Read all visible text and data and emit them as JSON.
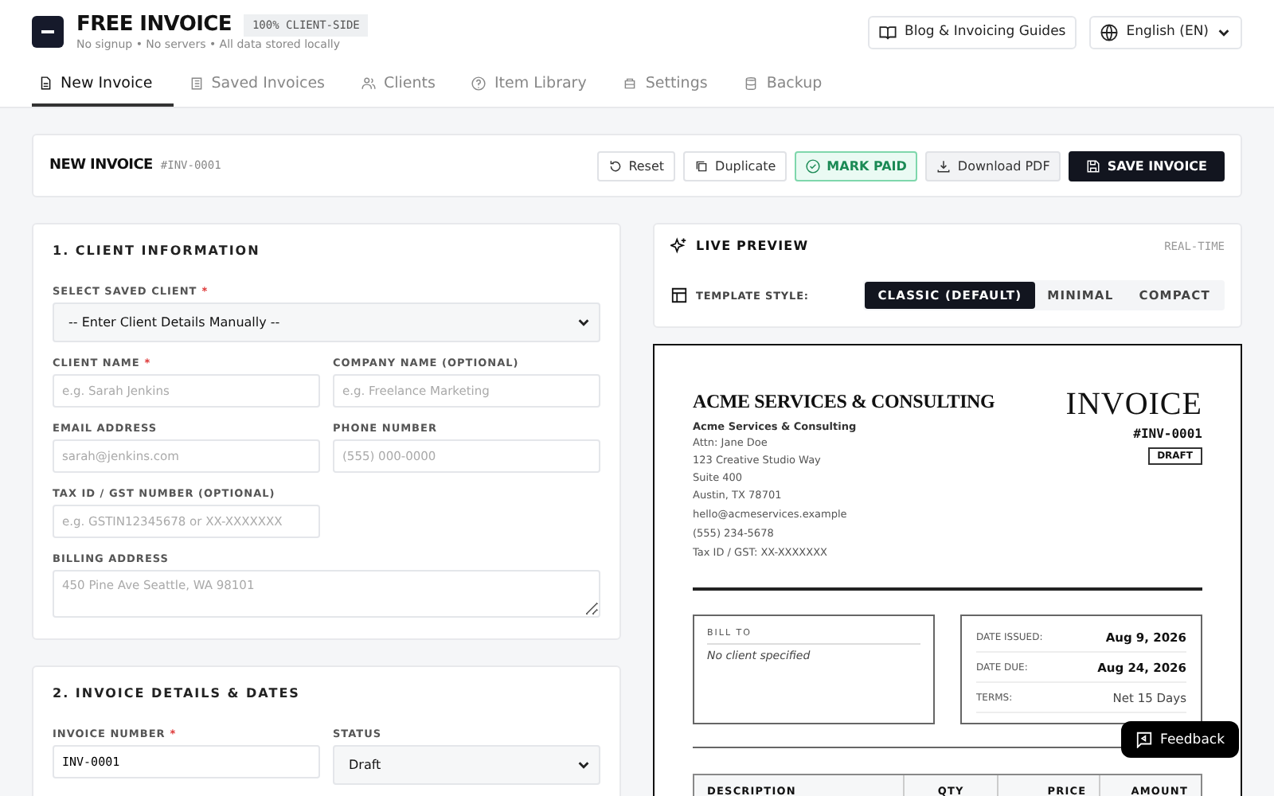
{
  "brand": {
    "title": "FREE INVOICE",
    "badge": "100% CLIENT-SIDE",
    "tagline": "No signup • No servers • All data stored locally"
  },
  "header_links": [
    {
      "kind": "guide",
      "label": "Blog & Invoicing Guides"
    },
    {
      "kind": "language",
      "label": "English (EN)"
    }
  ],
  "tabs": [
    {
      "kind": "file",
      "label": "New Invoice",
      "selected": true
    },
    {
      "kind": "list",
      "label": "Saved Invoices",
      "selected": false
    },
    {
      "kind": "users",
      "label": "Clients",
      "selected": false
    },
    {
      "kind": "tag",
      "label": "Item Library",
      "selected": false
    },
    {
      "kind": "gear",
      "label": "Settings",
      "selected": false
    },
    {
      "kind": "db",
      "label": "Backup",
      "selected": false
    }
  ],
  "toolbar": {
    "title": "NEW INVOICE",
    "number": "#INV-0001",
    "buttons": [
      {
        "kind": "reset",
        "label": "Reset"
      },
      {
        "kind": "duplicate",
        "label": "Duplicate"
      },
      {
        "kind": "paid",
        "label": "MARK PAID"
      },
      {
        "kind": "download",
        "label": "Download PDF"
      },
      {
        "kind": "save",
        "label": "SAVE INVOICE"
      }
    ]
  },
  "client_section": {
    "title": "1. CLIENT INFORMATION",
    "rows": [
      [
        {
          "kind": "select",
          "label": "SELECT SAVED CLIENT",
          "required_mark": "*",
          "value": "-- Enter Client Details Manually --"
        }
      ],
      [
        {
          "kind": "input",
          "label": "CLIENT NAME",
          "required_mark": "*",
          "placeholder": "e.g. Sarah Jenkins"
        },
        {
          "kind": "input",
          "label": "COMPANY NAME (OPTIONAL)",
          "placeholder": "e.g. Freelance Marketing"
        }
      ],
      [
        {
          "kind": "input",
          "label": "EMAIL ADDRESS",
          "placeholder": "sarah@jenkins.com"
        },
        {
          "kind": "input",
          "label": "PHONE NUMBER",
          "placeholder": "(555) 000-0000"
        }
      ],
      [
        {
          "kind": "input",
          "label": "TAX ID / GST NUMBER (OPTIONAL)",
          "placeholder": "e.g. GSTIN12345678 or XX-XXXXXXX"
        }
      ],
      [
        {
          "kind": "textarea",
          "label": "BILLING ADDRESS",
          "placeholder": "450 Pine Ave Seattle, WA 98101"
        }
      ]
    ]
  },
  "invoice_section": {
    "title": "2. INVOICE DETAILS & DATES",
    "rows": [
      [
        {
          "kind": "input",
          "label": "INVOICE NUMBER",
          "required_mark": "*",
          "value": "INV-0001"
        },
        {
          "kind": "select",
          "label": "STATUS",
          "value": "Draft"
        }
      ]
    ]
  },
  "preview": {
    "title": "LIVE PREVIEW",
    "badge": "REAL-TIME",
    "template_label": "TEMPLATE STYLE:",
    "templates": [
      {
        "label": "CLASSIC (DEFAULT)",
        "selected": true
      },
      {
        "label": "MINIMAL",
        "selected": false
      },
      {
        "label": "COMPACT",
        "selected": false
      }
    ]
  },
  "document": {
    "company_heading": "ACME SERVICES & CONSULTING",
    "company_name": "Acme Services & Consulting",
    "address_lines": [
      "Attn: Jane Doe",
      "123 Creative Studio Way",
      "Suite 400",
      "Austin, TX 78701"
    ],
    "email": "hello@acmeservices.example",
    "phone": "(555) 234-5678",
    "tax": "Tax ID / GST: XX-XXXXXXX",
    "title": "INVOICE",
    "number": "#INV-0001",
    "status": "DRAFT",
    "bill_to_label": "BILL TO",
    "bill_to_value": "No client specified",
    "meta": [
      {
        "label": "DATE ISSUED:",
        "value": "Aug 9, 2026",
        "bold": true
      },
      {
        "label": "DATE DUE:",
        "value": "Aug 24, 2026",
        "bold": true
      },
      {
        "label": "TERMS:",
        "value": "Net 15 Days",
        "bold": false
      }
    ],
    "columns": [
      "DESCRIPTION",
      "QTY",
      "PRICE",
      "AMOUNT"
    ]
  },
  "feedback": {
    "label": "Feedback"
  }
}
